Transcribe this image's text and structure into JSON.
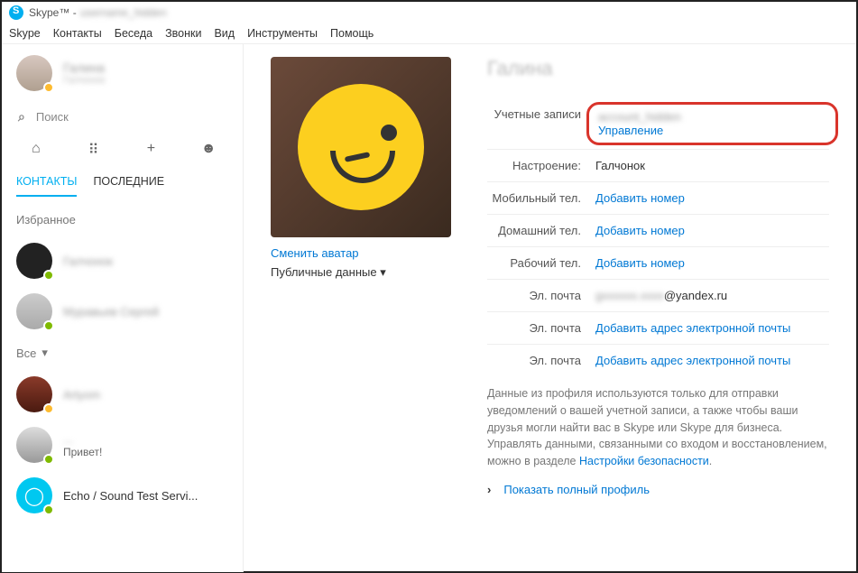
{
  "window": {
    "app": "Skype™",
    "username_blurred": "username_hidden"
  },
  "menubar": [
    "Skype",
    "Контакты",
    "Беседа",
    "Звонки",
    "Вид",
    "Инструменты",
    "Помощь"
  ],
  "self": {
    "name_blurred": "Галина",
    "sub_blurred": "Галчонок"
  },
  "search": {
    "placeholder": "Поиск"
  },
  "tabs": {
    "contacts": "КОНТАКТЫ",
    "recent": "ПОСЛЕДНИЕ"
  },
  "sections": {
    "favorites": "Избранное",
    "all": "Все"
  },
  "contacts": {
    "fav1_blurred": "Галчонок",
    "fav2_blurred": "Муравьев Сергей",
    "c1_blurred": "Artyom",
    "c2_blurred": "...",
    "c2_sub": "Привет!",
    "echo": "Echo / Sound Test Servi..."
  },
  "profile": {
    "name_blurred": "Галина",
    "change_avatar": "Сменить аватар",
    "public_data": "Публичные данные ▾",
    "fields": {
      "accounts_label": "Учетные записи",
      "account_val_blurred": "account_hidden",
      "manage": "Управление",
      "mood_label": "Настроение:",
      "mood_val": "Галчонок",
      "mobile_label": "Мобильный тел.",
      "add_number": "Добавить номер",
      "home_label": "Домашний тел.",
      "work_label": "Рабочий тел.",
      "email_label": "Эл. почта",
      "email_val_prefix_blurred": "gхххххх.хххх",
      "email_val_suffix": "@yandex.ru",
      "add_email": "Добавить адрес электронной почты"
    },
    "info_text_1": "Данные из профиля используются только для отправки уведомлений о вашей учетной записи, а также чтобы ваши друзья могли найти вас в Skype или Skype для бизнеса. Управлять данными, связанными со входом и восстановлением, можно в разделе ",
    "info_link": "Настройки безопасности",
    "info_text_2": ".",
    "show_full": "Показать полный профиль"
  }
}
